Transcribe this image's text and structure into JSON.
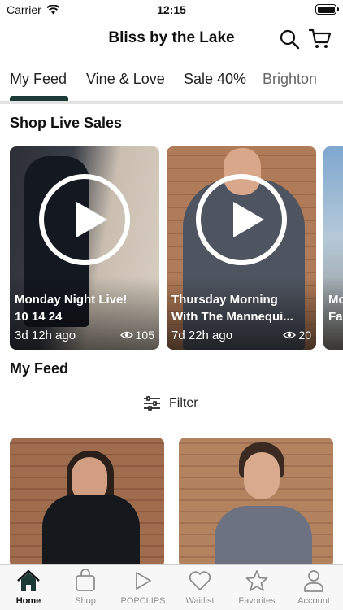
{
  "status_bar": {
    "carrier": "Carrier",
    "time": "12:15"
  },
  "header": {
    "title": "Bliss by the Lake",
    "search_icon": "search-icon",
    "cart_icon": "cart-icon"
  },
  "tabs": [
    {
      "label": "My Feed",
      "active": true
    },
    {
      "label": "Vine & Love"
    },
    {
      "label": "Sale 40%"
    },
    {
      "label": "Brighton"
    }
  ],
  "live_sales": {
    "title": "Shop Live Sales",
    "cards": [
      {
        "title_line1": "Monday Night Live!",
        "title_line2": "10 14 24",
        "age": "3d 12h ago",
        "views": "105"
      },
      {
        "title_line1": "Thursday Morning",
        "title_line2": "With The Mannequi...",
        "age": "7d 22h ago",
        "views": "20"
      },
      {
        "title_line1": "Mo",
        "title_line2": "Fa"
      }
    ]
  },
  "feed": {
    "title": "My Feed",
    "filter_label": "Filter"
  },
  "tabbar": [
    {
      "label": "Home",
      "icon": "home-icon",
      "active": true
    },
    {
      "label": "Shop",
      "icon": "bag-icon"
    },
    {
      "label": "POPCLIPS",
      "icon": "play-icon"
    },
    {
      "label": "Waitlist",
      "icon": "heart-icon"
    },
    {
      "label": "Favorites",
      "icon": "star-icon"
    },
    {
      "label": "Account",
      "icon": "person-icon"
    }
  ],
  "colors": {
    "accent": "#1c3a35",
    "text": "#111111",
    "tab_inactive": "#8e8e8e"
  }
}
